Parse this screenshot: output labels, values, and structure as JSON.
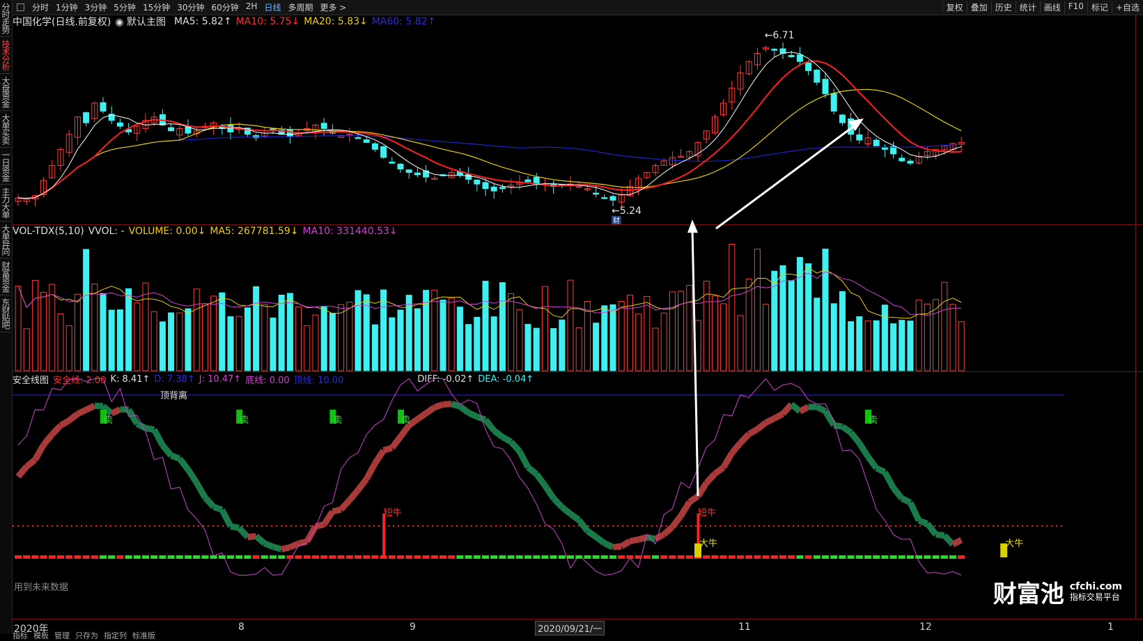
{
  "left_sidebar": {
    "items": [
      "分时走势",
      "技术分析",
      "大盘资金",
      "大单买卖",
      "一日资金",
      "主力大单",
      "大单异同",
      "财富资金",
      "东财贴吧"
    ],
    "active_index": 1
  },
  "toolbar": {
    "periods": [
      "分时",
      "1分钟",
      "3分钟",
      "5分钟",
      "15分钟",
      "30分钟",
      "60分钟",
      "2H",
      "日线",
      "多周期",
      "更多 >"
    ],
    "selected": "日线",
    "right_buttons": [
      "复权",
      "叠加",
      "历史",
      "统计",
      "画线",
      "F10",
      "标记",
      "+自选"
    ]
  },
  "main_panel": {
    "stock_title": "中国化学(日线.前复权)",
    "template": "默认主图",
    "ma5": "MA5: 5.82↑",
    "ma10": "MA10: 5.75↓",
    "ma20": "MA20: 5.83↓",
    "ma60": "MA60: 5.82↑",
    "high_label": "6.71",
    "low_label": "5.24",
    "cai_badge": "财",
    "colors": {
      "ma5": "#ffffff",
      "ma10": "#ff2020",
      "ma20": "#e8d000",
      "ma60": "#2020d0",
      "up": "#ff3c3c",
      "down": "#40f0f0"
    }
  },
  "volume_panel": {
    "name": "VOL-TDX(5,10)",
    "vvol": "VVOL: -",
    "volume": "VOLUME: 0.00↓",
    "ma5": "MA5: 267781.59↓",
    "ma10": "MA10: 331440.53↓"
  },
  "safety_panel": {
    "name": "安全线图",
    "safe_line": "安全线: 2.00",
    "k": "K: 8.41↑",
    "d": "D: 7.38↑",
    "j": "J: 10.47↑",
    "bottom_line": "底线: 0.00",
    "top_line": "顶线: 10.00",
    "diff": "DIFF: -0.02↑",
    "dea": "DEA: -0.04↑",
    "top_divergence": "顶背离",
    "sell_label": "卖",
    "short_bull": "短牛",
    "big_bull": "大牛"
  },
  "xaxis": {
    "year": "2020年",
    "months": [
      "8",
      "9",
      "11",
      "12",
      "1"
    ],
    "date_box": "2020/09/21/一"
  },
  "footnote": "用到未来数据",
  "watermark": {
    "big": "财富池",
    "site": "cfchi.com",
    "tag": "指标交易平台"
  },
  "bottom_tabs": [
    "指标",
    "模板",
    "管理",
    "只存为",
    "指定列",
    "标准版"
  ],
  "chart_data": {
    "type": "candlestick",
    "ylim": [
      5.24,
      6.71
    ],
    "closes": [
      5.3,
      5.29,
      5.32,
      5.45,
      5.58,
      5.72,
      5.85,
      6.0,
      5.95,
      6.12,
      6.05,
      5.97,
      5.92,
      5.87,
      5.92,
      5.97,
      6.0,
      5.93,
      5.88,
      5.9,
      5.86,
      5.88,
      5.92,
      5.95,
      5.9,
      5.87,
      5.9,
      5.85,
      5.82,
      5.86,
      5.88,
      5.85,
      5.83,
      5.86,
      5.9,
      5.93,
      5.9,
      5.86,
      5.84,
      5.85,
      5.82,
      5.78,
      5.72,
      5.65,
      5.6,
      5.55,
      5.52,
      5.5,
      5.48,
      5.47,
      5.5,
      5.52,
      5.5,
      5.46,
      5.42,
      5.38,
      5.36,
      5.38,
      5.41,
      5.43,
      5.44,
      5.42,
      5.42,
      5.4,
      5.41,
      5.42,
      5.4,
      5.38,
      5.34,
      5.3,
      5.28,
      5.33,
      5.4,
      5.47,
      5.52,
      5.58,
      5.62,
      5.65,
      5.66,
      5.7,
      5.78,
      5.88,
      6.0,
      6.12,
      6.25,
      6.38,
      6.48,
      6.55,
      6.6,
      6.58,
      6.55,
      6.52,
      6.48,
      6.4,
      6.3,
      6.2,
      6.05,
      5.95,
      5.85,
      5.8,
      5.82,
      5.75,
      5.72,
      5.68,
      5.62,
      5.6,
      5.66,
      5.7,
      5.72,
      5.75,
      5.77,
      5.78
    ]
  }
}
